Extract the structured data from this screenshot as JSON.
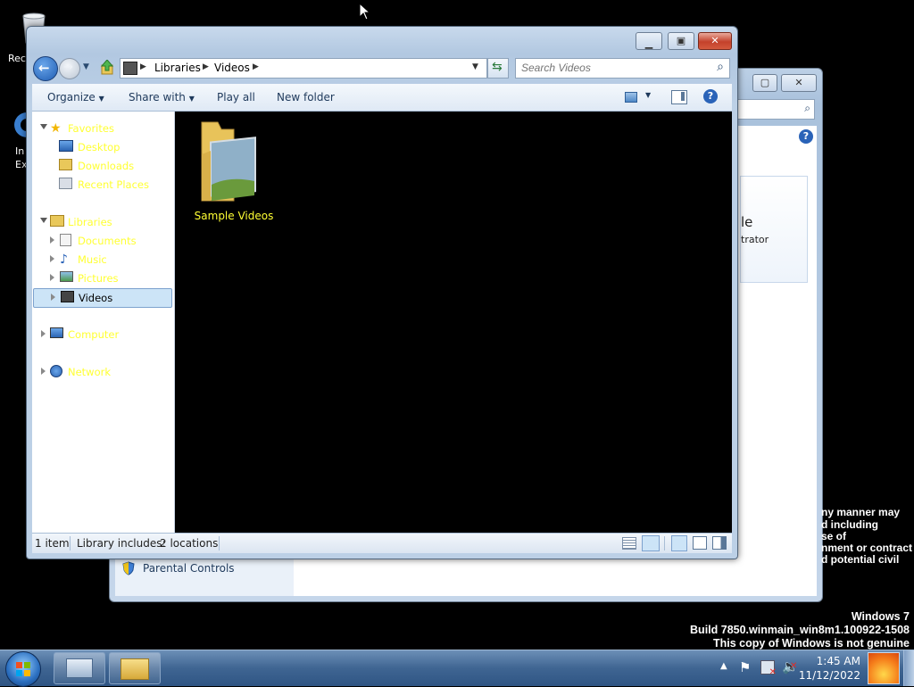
{
  "desktop": {
    "icons": [
      {
        "label": "Rec"
      },
      {
        "label": "In"
      },
      {
        "label": "Ex"
      }
    ]
  },
  "background_window": {
    "heading_fragment": "le",
    "subheading_fragment": "trator",
    "left_item": "Parental Controls"
  },
  "explorer": {
    "breadcrumb": [
      "Libraries",
      "Videos"
    ],
    "search_placeholder": "Search Videos",
    "toolbar": {
      "organize": "Organize",
      "share_with": "Share with",
      "play_all": "Play all",
      "new_folder": "New folder"
    },
    "nav": {
      "favorites": "Favorites",
      "desktop": "Desktop",
      "downloads": "Downloads",
      "recent_places": "Recent Places",
      "libraries": "Libraries",
      "documents": "Documents",
      "music": "Music",
      "pictures": "Pictures",
      "videos": "Videos",
      "computer": "Computer",
      "network": "Network"
    },
    "content": [
      {
        "name": "Sample Videos"
      }
    ],
    "status": {
      "count": "1 item",
      "library_includes": "Library includes:",
      "locations": "2 locations"
    }
  },
  "watermark": {
    "legal_lines": [
      "ny manner may",
      "d including",
      "se of",
      "nment or contract",
      "d potential civil"
    ],
    "os": "Windows 7",
    "build": "Build 7850.winmain_win8m1.100922-1508",
    "genuine": "This copy of Windows is not genuine"
  },
  "taskbar": {
    "time": "1:45 AM",
    "date": "11/12/2022"
  },
  "colors": {
    "nav_text": "#ffff33",
    "selection": "#cce4f7"
  }
}
